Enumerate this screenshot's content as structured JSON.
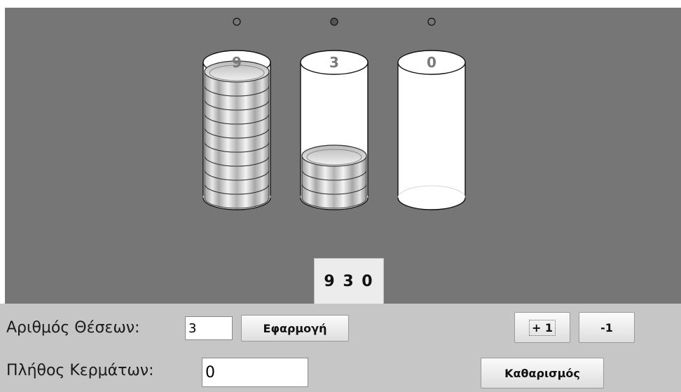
{
  "columns": [
    {
      "digit": "9",
      "coins": 9,
      "selected": false
    },
    {
      "digit": "3",
      "coins": 3,
      "selected": true
    },
    {
      "digit": "0",
      "coins": 0,
      "selected": false
    }
  ],
  "readout": "9 3 0",
  "controls": {
    "positions_label": "Αριθμός Θέσεων:",
    "positions_value": "3",
    "apply_label": "Εφαρμογή",
    "plus_label": "+ 1",
    "minus_label": "-1",
    "coins_label": "Πλήθος Κερμάτων:",
    "coins_value": "0",
    "clear_label": "Καθαρισμός"
  },
  "colors": {
    "background": "#767676",
    "panel": "#c6c6c6",
    "coin_light": "#ededed",
    "coin_dark": "#9a9a9a"
  }
}
